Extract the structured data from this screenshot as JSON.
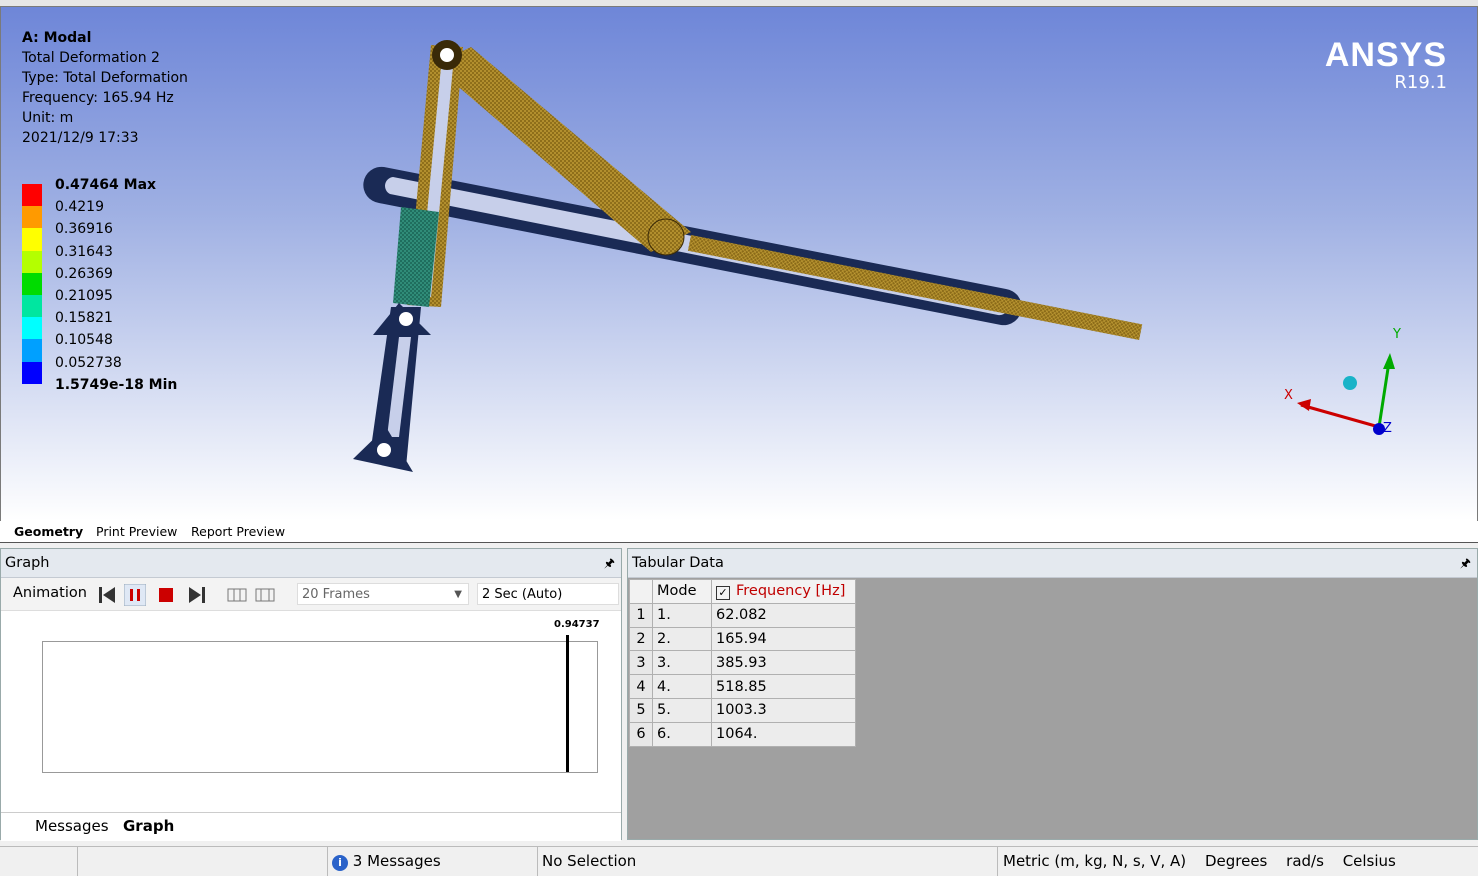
{
  "viewport": {
    "info": {
      "analysis": "A: Modal",
      "result_name": "Total Deformation 2",
      "type": "Type: Total Deformation",
      "frequency": "Frequency: 165.94 Hz",
      "unit": "Unit: m",
      "timestamp": "2021/12/9 17:33"
    },
    "legend": [
      {
        "label": "0.47464 Max",
        "color": "#ff0000",
        "bold": true
      },
      {
        "label": "0.4219",
        "color": "#ff9a00"
      },
      {
        "label": "0.36916",
        "color": "#ffff00"
      },
      {
        "label": "0.31643",
        "color": "#b4ff00"
      },
      {
        "label": "0.26369",
        "color": "#00dc00"
      },
      {
        "label": "0.21095",
        "color": "#00e6a0"
      },
      {
        "label": "0.15821",
        "color": "#00ffff"
      },
      {
        "label": "0.10548",
        "color": "#00a0ff"
      },
      {
        "label": "0.052738",
        "color": "#0000ff"
      },
      {
        "label": "1.5749e-18 Min",
        "color": "#0000ff",
        "bold": true
      }
    ],
    "brand": {
      "name": "ANSYS",
      "version": "R19.1"
    },
    "triad": {
      "x": "X",
      "y": "Y",
      "z": "Z"
    }
  },
  "view_tabs": [
    "Geometry",
    "Print Preview",
    "Report Preview"
  ],
  "graph": {
    "title": "Graph",
    "animation_label": "Animation",
    "frames": "20 Frames",
    "duration": "2 Sec (Auto)",
    "cursor_value": "0.94737",
    "bottom_tabs": [
      "Messages",
      "Graph"
    ]
  },
  "tabular": {
    "title": "Tabular Data",
    "columns": [
      "Mode",
      "Frequency [Hz]"
    ],
    "rows": [
      {
        "idx": "1",
        "mode": "1.",
        "freq": "62.082"
      },
      {
        "idx": "2",
        "mode": "2.",
        "freq": "165.94"
      },
      {
        "idx": "3",
        "mode": "3.",
        "freq": "385.93"
      },
      {
        "idx": "4",
        "mode": "4.",
        "freq": "518.85"
      },
      {
        "idx": "5",
        "mode": "5.",
        "freq": "1003.3"
      },
      {
        "idx": "6",
        "mode": "6.",
        "freq": "1064."
      }
    ]
  },
  "status": {
    "messages": "3 Messages",
    "selection": "No Selection",
    "units": "Metric (m, kg, N, s, V, A)",
    "angle": "Degrees",
    "angular_velocity": "rad/s",
    "temperature": "Celsius"
  }
}
